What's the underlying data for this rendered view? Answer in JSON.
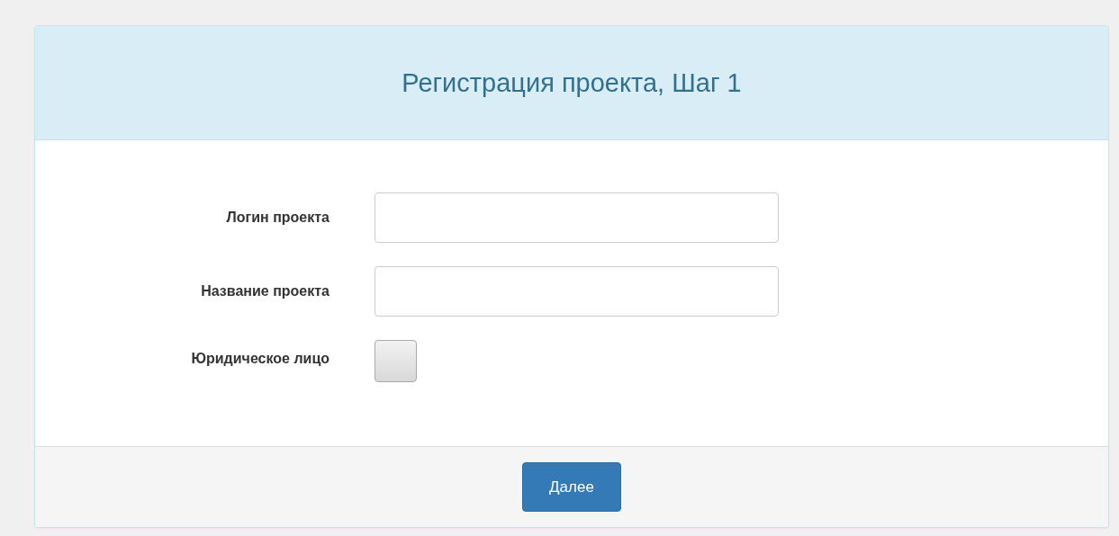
{
  "panel": {
    "title": "Регистрация проекта, Шаг 1"
  },
  "fields": [
    {
      "kind": "text",
      "label": "Логин проекта"
    },
    {
      "kind": "text",
      "label": "Название проекта"
    },
    {
      "kind": "checkbox",
      "label": "Юридическое лицо",
      "checked": false
    }
  ],
  "footer": {
    "button": "Далее"
  }
}
